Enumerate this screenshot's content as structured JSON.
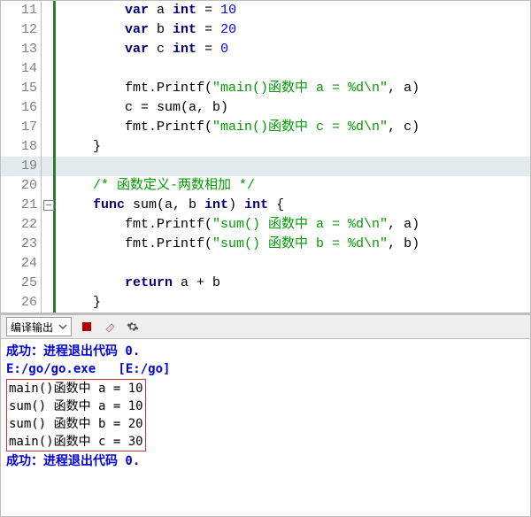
{
  "editor": {
    "lines": [
      {
        "n": "11",
        "hl": false,
        "fold": "",
        "segs": [
          {
            "t": "        "
          },
          {
            "t": "var",
            "c": "kw"
          },
          {
            "t": " a "
          },
          {
            "t": "int",
            "c": "typ"
          },
          {
            "t": " = "
          },
          {
            "t": "10",
            "c": "num"
          }
        ]
      },
      {
        "n": "12",
        "hl": false,
        "fold": "",
        "segs": [
          {
            "t": "        "
          },
          {
            "t": "var",
            "c": "kw"
          },
          {
            "t": " b "
          },
          {
            "t": "int",
            "c": "typ"
          },
          {
            "t": " = "
          },
          {
            "t": "20",
            "c": "num"
          }
        ]
      },
      {
        "n": "13",
        "hl": false,
        "fold": "",
        "segs": [
          {
            "t": "        "
          },
          {
            "t": "var",
            "c": "kw"
          },
          {
            "t": " c "
          },
          {
            "t": "int",
            "c": "typ"
          },
          {
            "t": " = "
          },
          {
            "t": "0",
            "c": "num"
          }
        ]
      },
      {
        "n": "14",
        "hl": false,
        "fold": "",
        "segs": []
      },
      {
        "n": "15",
        "hl": false,
        "fold": "",
        "segs": [
          {
            "t": "        fmt.Printf("
          },
          {
            "t": "\"main()函数中 a = %d\\n\"",
            "c": "str"
          },
          {
            "t": ", a)"
          }
        ]
      },
      {
        "n": "16",
        "hl": false,
        "fold": "",
        "segs": [
          {
            "t": "        c = sum(a, b)"
          }
        ]
      },
      {
        "n": "17",
        "hl": false,
        "fold": "",
        "segs": [
          {
            "t": "        fmt.Printf("
          },
          {
            "t": "\"main()函数中 c = %d\\n\"",
            "c": "str"
          },
          {
            "t": ", c)"
          }
        ]
      },
      {
        "n": "18",
        "hl": false,
        "fold": "",
        "segs": [
          {
            "t": "    }"
          }
        ]
      },
      {
        "n": "19",
        "hl": true,
        "fold": "",
        "segs": []
      },
      {
        "n": "20",
        "hl": false,
        "fold": "",
        "segs": [
          {
            "t": "    "
          },
          {
            "t": "/* 函数定义-两数相加 */",
            "c": "cmt"
          }
        ]
      },
      {
        "n": "21",
        "hl": false,
        "fold": "mark",
        "segs": [
          {
            "t": "    "
          },
          {
            "t": "func",
            "c": "kw"
          },
          {
            "t": " sum(a, b "
          },
          {
            "t": "int",
            "c": "typ"
          },
          {
            "t": ") "
          },
          {
            "t": "int",
            "c": "typ"
          },
          {
            "t": " {"
          }
        ]
      },
      {
        "n": "22",
        "hl": false,
        "fold": "",
        "segs": [
          {
            "t": "        fmt.Printf("
          },
          {
            "t": "\"sum() 函数中 a = %d\\n\"",
            "c": "str"
          },
          {
            "t": ", a)"
          }
        ]
      },
      {
        "n": "23",
        "hl": false,
        "fold": "",
        "segs": [
          {
            "t": "        fmt.Printf("
          },
          {
            "t": "\"sum() 函数中 b = %d\\n\"",
            "c": "str"
          },
          {
            "t": ", b)"
          }
        ]
      },
      {
        "n": "24",
        "hl": false,
        "fold": "",
        "segs": []
      },
      {
        "n": "25",
        "hl": false,
        "fold": "",
        "segs": [
          {
            "t": "        "
          },
          {
            "t": "return",
            "c": "kw"
          },
          {
            "t": " a + b"
          }
        ]
      },
      {
        "n": "26",
        "hl": false,
        "fold": "",
        "segs": [
          {
            "t": "    }"
          }
        ]
      }
    ]
  },
  "toolbar": {
    "dropdown_label": "编译输出"
  },
  "output": {
    "line1": "成功：进程退出代码 0.",
    "line2": "E:/go/go.exe   [E:/go]",
    "boxed": [
      "main()函数中 a = 10",
      "sum() 函数中 a = 10",
      "sum() 函数中 b = 20",
      "main()函数中 c = 30"
    ],
    "line3": "成功：进程退出代码 0."
  }
}
